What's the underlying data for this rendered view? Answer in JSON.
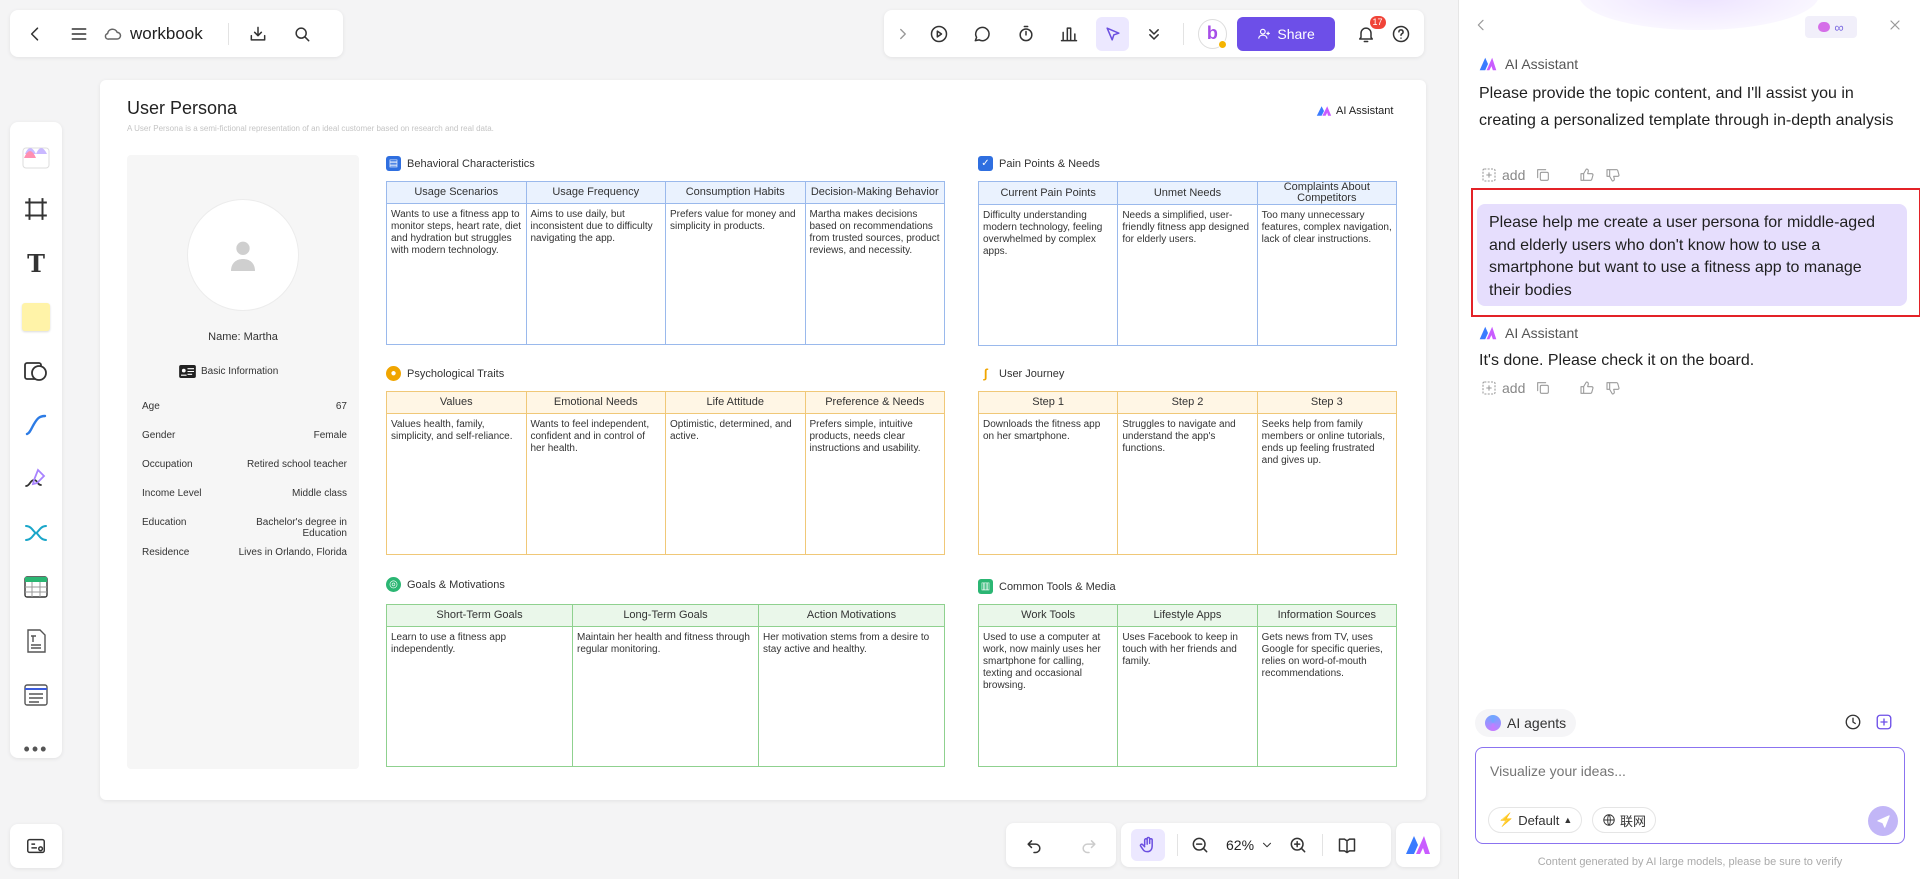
{
  "topbar": {
    "doc_title": "workbook",
    "share_label": "Share",
    "notif_count": "17"
  },
  "board": {
    "title": "User Persona",
    "subtitle": "A User Persona is a semi-fictional representation of an ideal customer based on research and real data.",
    "brand": "AI Assistant",
    "profile": {
      "name": "Name: Martha",
      "basic_info": "Basic Information",
      "rows": [
        {
          "label": "Age",
          "value": "67"
        },
        {
          "label": "Gender",
          "value": "Female"
        },
        {
          "label": "Occupation",
          "value": "Retired school teacher"
        },
        {
          "label": "Income Level",
          "value": "Middle class"
        },
        {
          "label": "Education",
          "value": "Bachelor's degree in Education"
        },
        {
          "label": "Residence",
          "value": "Lives in Orlando, Florida"
        }
      ]
    },
    "sections": {
      "behavioral": {
        "title": "Behavioral Characteristics",
        "headers": [
          "Usage Scenarios",
          "Usage Frequency",
          "Consumption Habits",
          "Decision-Making Behavior"
        ],
        "cells": [
          "Wants to use a fitness app to monitor steps, heart rate, diet and hydration but struggles with modern technology.",
          "Aims to use daily, but inconsistent due to difficulty navigating the app.",
          "Prefers value for money and simplicity in products.",
          "Martha makes decisions based on recommendations from trusted sources, product reviews, and necessity."
        ]
      },
      "pain": {
        "title": "Pain Points & Needs",
        "headers": [
          "Current Pain Points",
          "Unmet Needs",
          "Complaints About Competitors"
        ],
        "cells": [
          "Difficulty understanding modern technology, feeling overwhelmed by complex apps.",
          "Needs a simplified, user-friendly fitness app designed for elderly users.",
          "Too many unnecessary features, complex navigation, lack of clear instructions."
        ]
      },
      "psych": {
        "title": "Psychological Traits",
        "headers": [
          "Values",
          "Emotional Needs",
          "Life Attitude",
          "Preference & Needs"
        ],
        "cells": [
          "Values health, family, simplicity, and self-reliance.",
          "Wants to feel independent, confident and in control of her health.",
          "Optimistic, determined, and active.",
          "Prefers simple, intuitive products, needs clear instructions and usability."
        ]
      },
      "journey": {
        "title": "User Journey",
        "headers": [
          "Step 1",
          "Step 2",
          "Step 3"
        ],
        "cells": [
          "Downloads the fitness app on her smartphone.",
          "Struggles to navigate and understand the app's functions.",
          "Seeks help from family members or online tutorials, ends up feeling frustrated and gives up."
        ]
      },
      "goals": {
        "title": "Goals & Motivations",
        "headers": [
          "Short-Term Goals",
          "Long-Term Goals",
          "Action Motivations"
        ],
        "cells": [
          "Learn to use a fitness app independently.",
          "Maintain her health and fitness through regular monitoring.",
          "Her motivation stems from a desire to stay active and healthy."
        ]
      },
      "tools": {
        "title": "Common Tools & Media",
        "headers": [
          "Work Tools",
          "Lifestyle Apps",
          "Information Sources"
        ],
        "cells": [
          "Used to use a computer at work, now mainly uses her smartphone for calling, texting and occasional browsing.",
          "Uses Facebook to keep in touch with her friends and family.",
          "Gets news from TV, uses Google for specific queries, relies on word-of-mouth recommendations."
        ]
      }
    }
  },
  "bottombar": {
    "zoom": "62%"
  },
  "panel": {
    "assistant_name": "AI Assistant",
    "msg1": "Please provide the topic content, and I'll assist you in creating a personalized template through in-depth analysis",
    "add_label": "add",
    "user_msg": "Please help me create a user persona for middle-aged and elderly users who don't know how to use a smartphone but want to use a fitness app to manage their bodies",
    "msg2": "It's done. Please check it on the board.",
    "agents_label": "AI agents",
    "input_placeholder": "Visualize your ideas...",
    "mode_label": "Default",
    "web_label": "联网",
    "footer": "Content generated by AI large models, please be sure to verify"
  }
}
